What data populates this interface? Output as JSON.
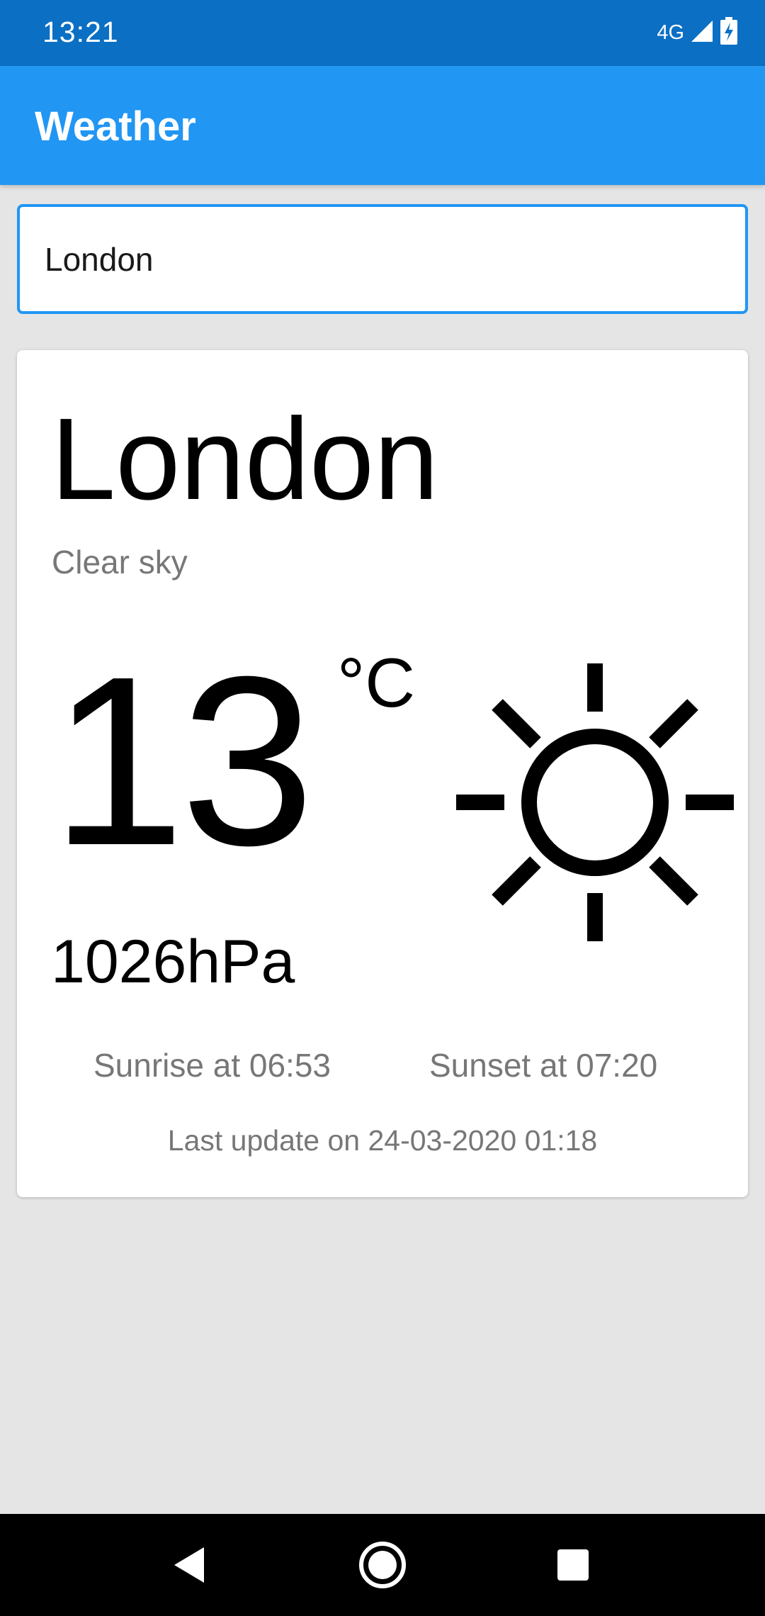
{
  "status_bar": {
    "time": "13:21",
    "network": "4G",
    "icons": [
      "signal-icon",
      "battery-charging-icon"
    ]
  },
  "app_bar": {
    "title": "Weather"
  },
  "search": {
    "value": "London",
    "placeholder": ""
  },
  "weather": {
    "city": "London",
    "description": "Clear sky",
    "temperature": "13",
    "unit": "°C",
    "icon": "sun-icon",
    "pressure": "1026hPa",
    "sunrise": "Sunrise at 06:53",
    "sunset": "Sunset at 07:20",
    "last_update": "Last update on 24-03-2020 01:18"
  },
  "nav_bar": {
    "icons": [
      "back-icon",
      "home-icon",
      "recents-icon"
    ]
  },
  "colors": {
    "status_bar": "#0b6fc4",
    "app_bar": "#2196f3",
    "background": "#e5e5e5",
    "secondary_text": "#777777"
  }
}
